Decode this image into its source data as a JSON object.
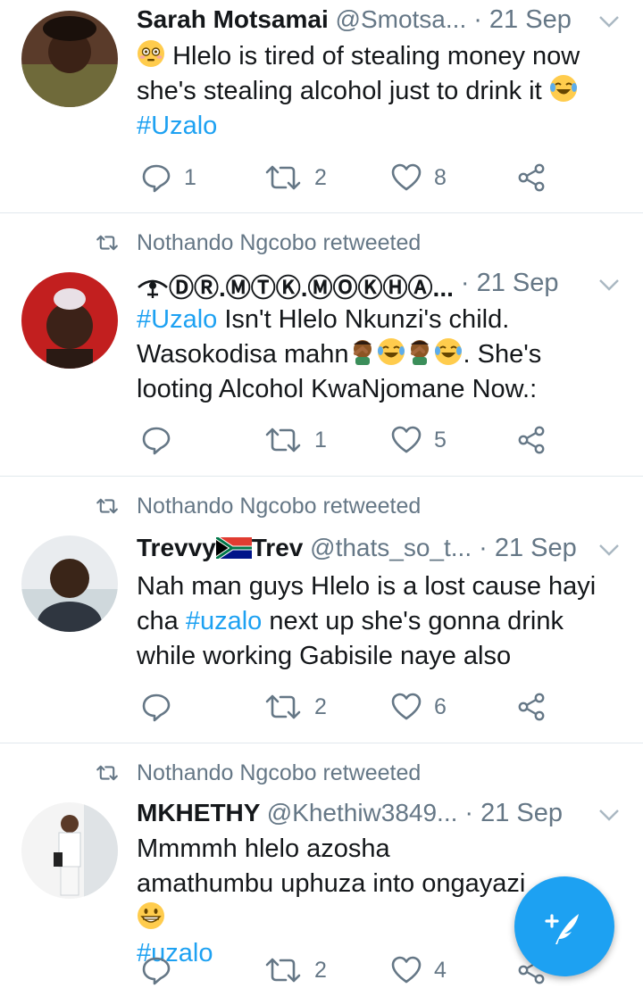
{
  "tweets": [
    {
      "retweeted_by": "",
      "name": "Sarah Motsamai",
      "handle": "@Smotsa...",
      "time": "· 21 Sep",
      "text_parts": [
        "Hlelo is tired of stealing money now she's stealing alcohol just to drink it",
        "#Uzalo"
      ],
      "reply_count": "1",
      "retweet_count": "2",
      "like_count": "8"
    },
    {
      "retweeted_by": "Nothando Ngcobo retweeted",
      "name": "ⒹⓇ.ⓂⓉⓀ.ⓂⓄⓀⒽⒶ...",
      "handle": "",
      "time": "· 21 Sep",
      "text_parts": [
        "#Uzalo",
        "Isn't Hlelo Nkunzi's child. Wasokodisa mahn",
        ". She's looting Alcohol KwaNjomane Now.:"
      ],
      "reply_count": "",
      "retweet_count": "1",
      "like_count": "5"
    },
    {
      "retweeted_by": "Nothando Ngcobo retweeted",
      "name": "Trevvy",
      "name_suffix": "Trev",
      "handle": "@thats_so_t...",
      "time": "· 21 Sep",
      "text_parts": [
        "Nah man guys Hlelo is a lost cause hayi cha",
        "#uzalo",
        "next up she's gonna drink while working Gabisile naye also"
      ],
      "reply_count": "",
      "retweet_count": "2",
      "like_count": "6"
    },
    {
      "retweeted_by": "Nothando Ngcobo retweeted",
      "name": "MKHETHY",
      "handle": "@Khethiw3849...",
      "time": "· 21 Sep",
      "text_parts": [
        "Mmmmh hlelo azosha amathumbu uphuza into ongayazi",
        "#uzalo"
      ],
      "reply_count": "",
      "retweet_count": "2",
      "like_count": "4"
    }
  ],
  "colors": {
    "accent": "#1da1f2",
    "muted": "#657786",
    "text": "#14171a",
    "divider": "#e1e8ed"
  },
  "icons": [
    "reply-icon",
    "retweet-icon",
    "like-icon",
    "share-icon",
    "compose-tweet-icon",
    "chevron-down-icon"
  ]
}
